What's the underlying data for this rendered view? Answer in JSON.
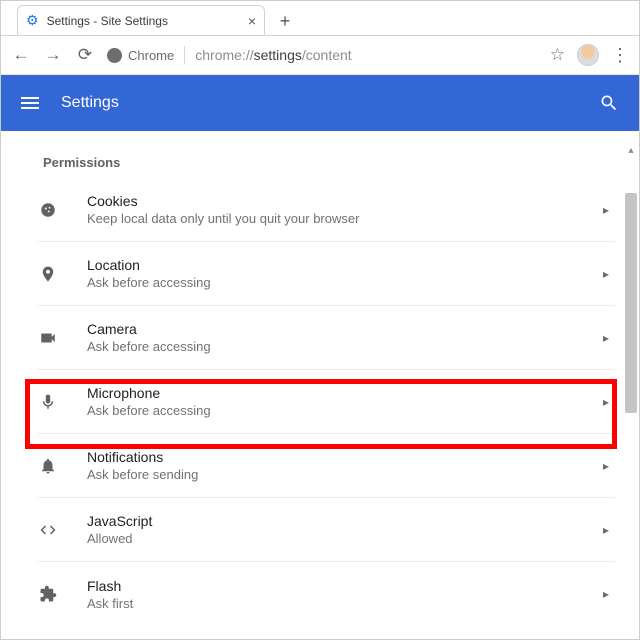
{
  "window": {
    "tab_title": "Settings - Site Settings"
  },
  "omnibox": {
    "chip": "Chrome",
    "url_gray": "chrome://",
    "url_dark": "settings",
    "url_tail": "/content"
  },
  "appbar": {
    "title": "Settings"
  },
  "section": {
    "title": "Permissions"
  },
  "perms": {
    "cookies": {
      "title": "Cookies",
      "subtitle": "Keep local data only until you quit your browser"
    },
    "location": {
      "title": "Location",
      "subtitle": "Ask before accessing"
    },
    "camera": {
      "title": "Camera",
      "subtitle": "Ask before accessing"
    },
    "microphone": {
      "title": "Microphone",
      "subtitle": "Ask before accessing"
    },
    "notifications": {
      "title": "Notifications",
      "subtitle": "Ask before sending"
    },
    "javascript": {
      "title": "JavaScript",
      "subtitle": "Allowed"
    },
    "flash": {
      "title": "Flash",
      "subtitle": "Ask first"
    }
  }
}
